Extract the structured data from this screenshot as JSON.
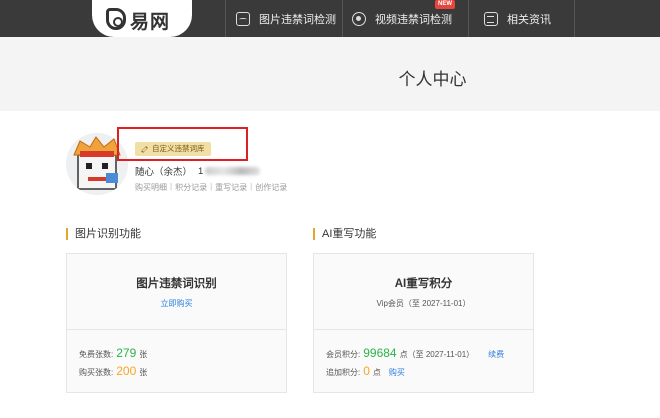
{
  "nav": {
    "logo": "易网",
    "items": [
      {
        "label": "图片违禁词检测",
        "icon": "image-scan-icon"
      },
      {
        "label": "视频违禁词检测",
        "icon": "video-scan-icon"
      },
      {
        "label": "相关资讯",
        "icon": "news-icon"
      }
    ],
    "new_badge": "NEW"
  },
  "hero": {
    "title": "个人中心"
  },
  "profile": {
    "custom_button": "自定义违禁词库",
    "nickname": "随心（余杰）",
    "phone_prefix": "1",
    "links": [
      "购买明细",
      "积分记录",
      "重写记录",
      "创作记录"
    ]
  },
  "sections": {
    "image": {
      "title": "图片识别功能",
      "card_title": "图片违禁词识别",
      "buy_link": "立即购买",
      "free_label": "免费张数:",
      "free_value": "279",
      "free_unit": "张",
      "bought_label": "购买张数:",
      "bought_value": "200",
      "bought_unit": "张"
    },
    "ai": {
      "title": "AI重写功能",
      "card_title": "AI重写积分",
      "vip_text": "Vip会员（至 2027-11-01）",
      "member_label": "会员积分:",
      "member_value": "99684",
      "member_unit": "点（至 2027-11-01）",
      "renew_link": "续费",
      "extra_label": "追加积分:",
      "extra_value": "0",
      "extra_unit": "点",
      "buy_link": "购买"
    }
  },
  "colors": {
    "nav_bg": "#3a3a3a",
    "accent": "#e5a530",
    "green": "#2bb34a",
    "orange": "#f5a623",
    "link": "#2b7de0",
    "highlight": "#e02020"
  }
}
